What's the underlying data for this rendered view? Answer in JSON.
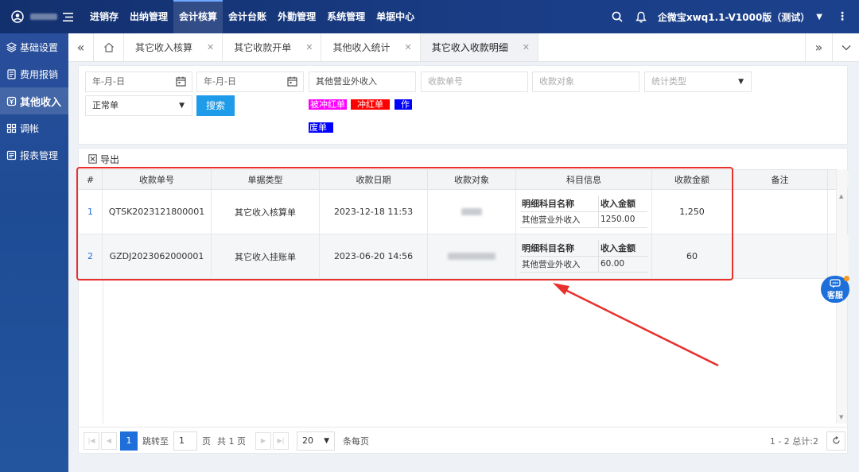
{
  "topbar": {
    "nav": [
      "进销存",
      "出纳管理",
      "会计核算",
      "会计台账",
      "外勤管理",
      "系统管理",
      "单据中心"
    ],
    "active_nav": "会计核算",
    "company": "企微宝xwq1.1-V1000版（测试）"
  },
  "sidebar": {
    "items": [
      {
        "label": "基础设置",
        "icon": "layers-icon"
      },
      {
        "label": "费用报销",
        "icon": "receipt-icon"
      },
      {
        "label": "其他收入",
        "icon": "income-icon"
      },
      {
        "label": "调帐",
        "icon": "grid-icon"
      },
      {
        "label": "报表管理",
        "icon": "report-icon"
      }
    ],
    "active": "其他收入"
  },
  "tabs": {
    "items": [
      "其它收入核算",
      "其它收款开单",
      "其他收入统计",
      "其它收入收款明细"
    ],
    "active": "其它收入收款明细"
  },
  "filter": {
    "date_start": "年-月-日",
    "date_end": "年-月-日",
    "income_subject": "其他营业外收入",
    "receipt_no_placeholder": "收款单号",
    "receipt_target_placeholder": "收款对象",
    "stat_type_placeholder": "统计类型",
    "doc_status": "正常单",
    "search_label": "搜索",
    "legend": {
      "red_flushed": "被冲红单",
      "red_flush": "冲红单",
      "void_part1": "作",
      "void_part2": "废单"
    }
  },
  "colors": {
    "red_flushed": "#ff00ff",
    "red_flush": "#ff0000",
    "void": "#0000ff",
    "accent": "#1e9be9",
    "annotation": "#e8302d"
  },
  "grid": {
    "export_label": "导出",
    "columns": [
      "#",
      "收款单号",
      "单据类型",
      "收款日期",
      "收款对象",
      "科目信息",
      "收款金额",
      "备注"
    ],
    "sub_columns": [
      "明细科目名称",
      "收入金额"
    ],
    "rows": [
      {
        "idx": "1",
        "receipt_no": "QTSK2023121800001",
        "type": "其它收入核算单",
        "date": "2023-12-18 11:53",
        "subject": "其他营业外收入",
        "subject_amount": "1250.00",
        "amount": "1,250",
        "note": ""
      },
      {
        "idx": "2",
        "receipt_no": "GZDJ2023062000001",
        "type": "其它收入挂账单",
        "date": "2023-06-20 14:56",
        "subject": "其他营业外收入",
        "subject_amount": "60.00",
        "amount": "60",
        "note": ""
      }
    ]
  },
  "pager": {
    "current": "1",
    "goto_label": "跳转至",
    "goto_value": "1",
    "page_label": "页",
    "total_pages": "共 1 页",
    "page_size": "20",
    "per_page_label": "条每页",
    "summary": "1 - 2  总计:2"
  },
  "chat": {
    "label": "客服"
  }
}
